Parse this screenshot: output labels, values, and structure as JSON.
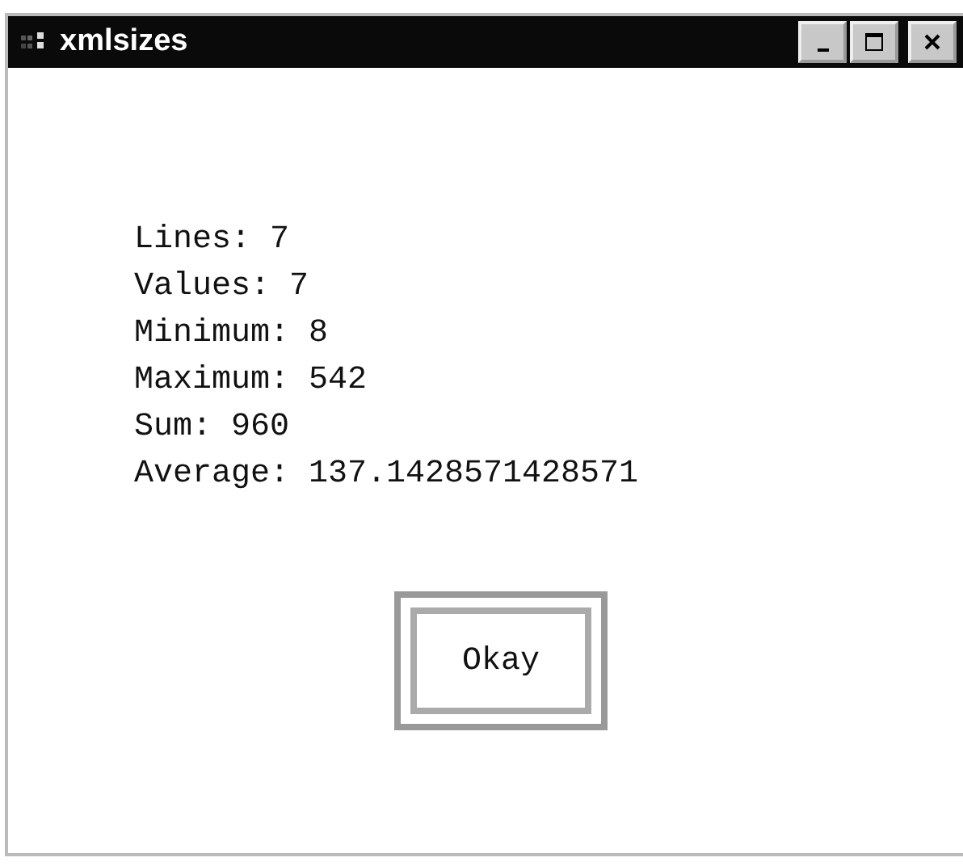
{
  "window": {
    "title": "xmlsizes"
  },
  "lines": [
    "Lines: 7",
    "Values: 7",
    "Minimum: 8",
    "Maximum: 542",
    "Sum: 960",
    "Average: 137.1428571428571"
  ],
  "buttons": [
    "Okay"
  ]
}
